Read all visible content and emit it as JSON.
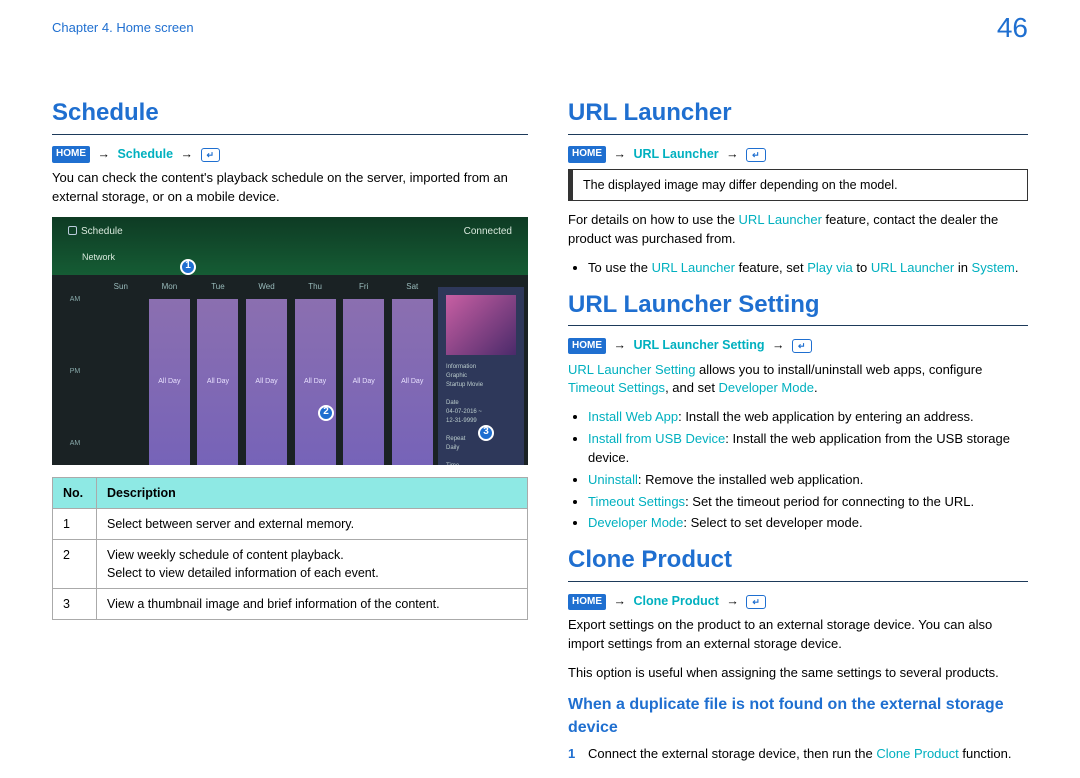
{
  "header": {
    "chapter": "Chapter 4. Home screen",
    "page_number": "46"
  },
  "nav": {
    "home_badge": "HOME",
    "arrow": "→",
    "enter_glyph": "↵"
  },
  "schedule": {
    "title": "Schedule",
    "path_step": "Schedule",
    "intro": "You can check the content's playback schedule on the server, imported from an external storage, or on a mobile device.",
    "ui": {
      "title": "Schedule",
      "connected": "Connected",
      "network": "Network",
      "days": [
        "Sun",
        "Mon",
        "Tue",
        "Wed",
        "Thu",
        "Fri",
        "Sat"
      ],
      "allday": "All Day",
      "info_label": "Information",
      "callouts": [
        "1",
        "2",
        "3"
      ]
    },
    "table": {
      "col_no": "No.",
      "col_desc": "Description",
      "rows": [
        {
          "no": "1",
          "desc": "Select between server and external memory."
        },
        {
          "no": "2",
          "desc": "View weekly schedule of content playback.\nSelect to view detailed information of each event."
        },
        {
          "no": "3",
          "desc": "View a thumbnail image and brief information of the content."
        }
      ]
    }
  },
  "url_launcher": {
    "title": "URL Launcher",
    "path_step": "URL Launcher",
    "note": "The displayed image may differ depending on the model.",
    "para_pre": "For details on how to use the ",
    "para_link": "URL Launcher",
    "para_post": " feature, contact the dealer the product was purchased from.",
    "bullet_pre": "To use the ",
    "bullet_l1": "URL Launcher",
    "bullet_mid1": " feature, set ",
    "bullet_l2": "Play via",
    "bullet_mid2": " to ",
    "bullet_l3": "URL Launcher",
    "bullet_mid3": " in ",
    "bullet_l4": "System",
    "bullet_end": "."
  },
  "url_launcher_setting": {
    "title": "URL Launcher Setting",
    "path_step": "URL Launcher Setting",
    "p1_l1": "URL Launcher Setting",
    "p1_t1": " allows you to install/uninstall web apps, configure ",
    "p1_l2": "Timeout Settings",
    "p1_t2": ", and set ",
    "p1_l3": "Developer Mode",
    "p1_t3": ".",
    "items": [
      {
        "label": "Install Web App",
        "text": ": Install the web application by entering an address."
      },
      {
        "label": "Install from USB Device",
        "text": ": Install the web application from the USB storage device."
      },
      {
        "label": "Uninstall",
        "text": ": Remove the installed web application."
      },
      {
        "label": "Timeout Settings",
        "text": ": Set the timeout period for connecting to the URL."
      },
      {
        "label": "Developer Mode",
        "text": ": Select to set developer mode."
      }
    ]
  },
  "clone_product": {
    "title": "Clone Product",
    "path_step": "Clone Product",
    "p1": "Export settings on the product to an external storage device. You can also import settings from an external storage device.",
    "p2": "This option is useful when assigning the same settings to several products.",
    "sub_title": "When a duplicate file is not found on the external storage device",
    "step1_num": "1",
    "step1_pre": "Connect the external storage device, then run the ",
    "step1_link": "Clone Product",
    "step1_post": " function."
  }
}
